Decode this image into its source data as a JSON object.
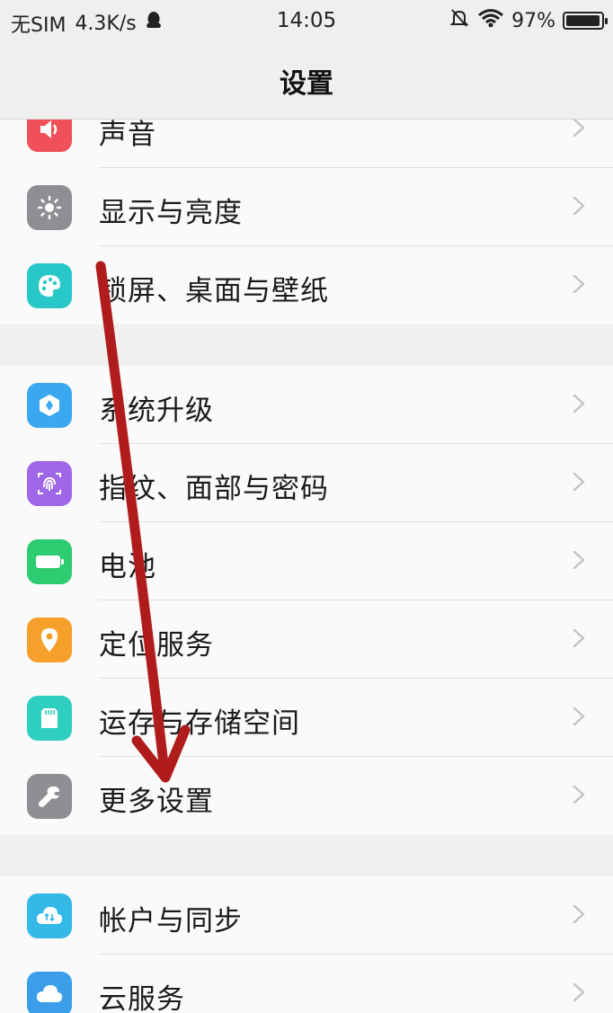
{
  "status_bar": {
    "carrier": "无SIM",
    "speed": "4.3K/s",
    "time": "14:05",
    "battery_text": "97%",
    "battery_level": 0.97,
    "icons": [
      "qq-icon",
      "silent-bell-icon",
      "wifi-icon",
      "battery-icon"
    ]
  },
  "header": {
    "title": "设置"
  },
  "groups": [
    {
      "items": [
        {
          "label": "声音",
          "icon": "sound-icon",
          "color": "#f0505a"
        },
        {
          "label": "显示与亮度",
          "icon": "brightness-icon",
          "color": "#8e8e93"
        },
        {
          "label": "锁屏、桌面与壁纸",
          "icon": "palette-icon",
          "color": "#28c8c8"
        }
      ]
    },
    {
      "items": [
        {
          "label": "系统升级",
          "icon": "system-update-icon",
          "color": "#3aa8f0"
        },
        {
          "label": "指纹、面部与密码",
          "icon": "fingerprint-icon",
          "color": "#a066e8"
        },
        {
          "label": "电池",
          "icon": "battery-icon",
          "color": "#2ecc71"
        },
        {
          "label": "定位服务",
          "icon": "location-icon",
          "color": "#f5a02a"
        },
        {
          "label": "运存与存储空间",
          "icon": "storage-icon",
          "color": "#2ecfc0"
        },
        {
          "label": "更多设置",
          "icon": "wrench-icon",
          "color": "#8e8e93"
        }
      ]
    },
    {
      "items": [
        {
          "label": "帐户与同步",
          "icon": "cloud-sync-icon",
          "color": "#33b8e8"
        },
        {
          "label": "云服务",
          "icon": "cloud-icon",
          "color": "#3a9ee8"
        }
      ]
    }
  ],
  "annotation": {
    "color": "#b01c1c"
  }
}
